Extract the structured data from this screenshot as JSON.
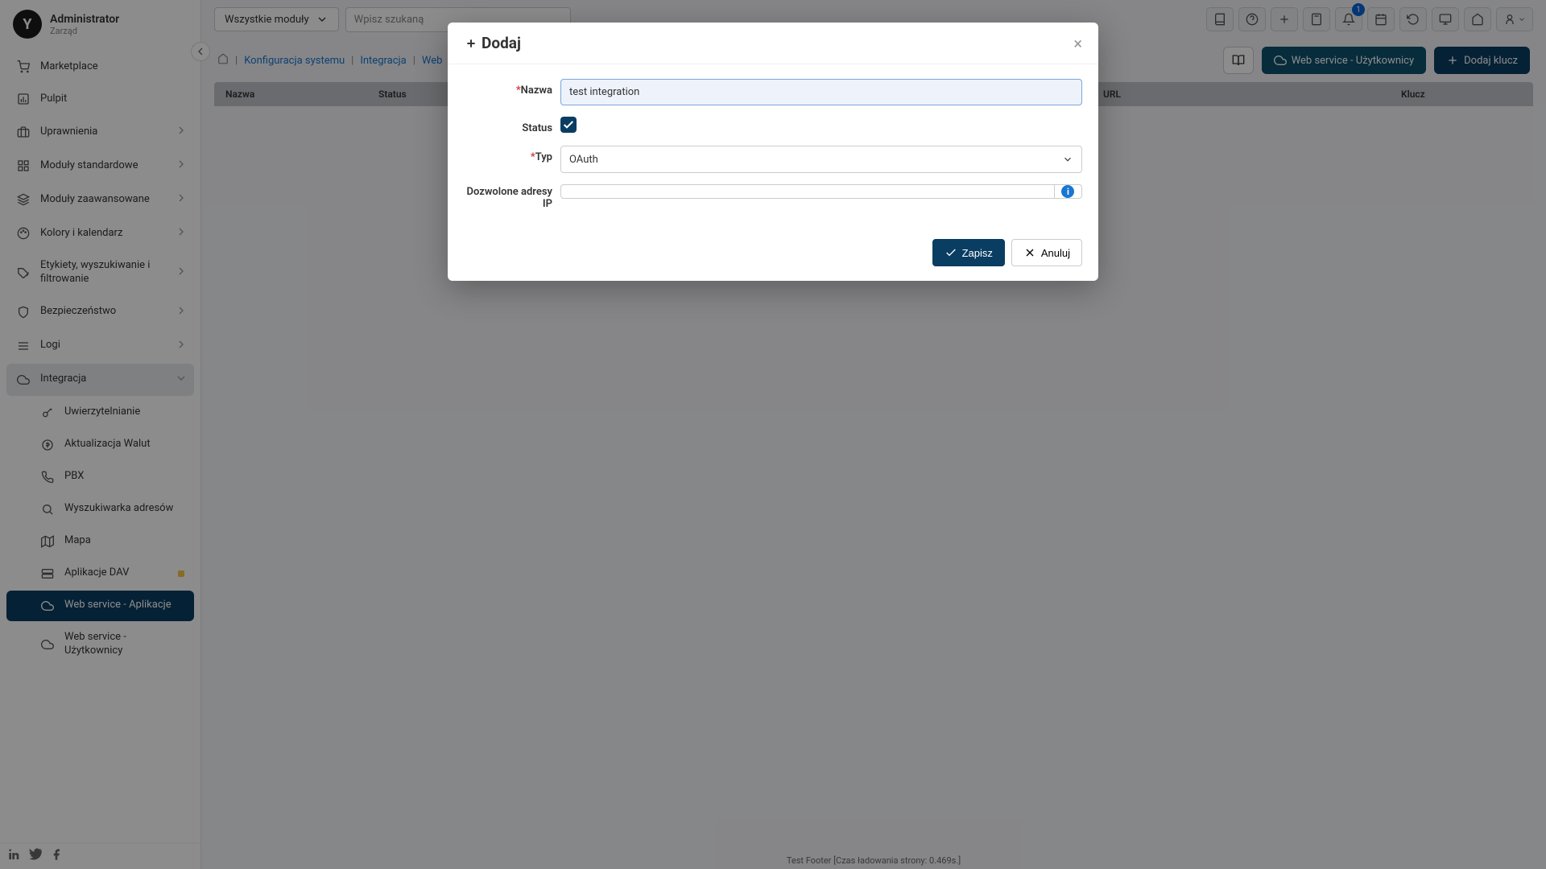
{
  "logo": "Y",
  "admin": {
    "name": "Administrator",
    "role": "Zarząd"
  },
  "topbar": {
    "module_select": "Wszystkie moduły",
    "search_placeholder": "Wpisz szukaną",
    "notif_count": "1"
  },
  "sidebar": {
    "items": [
      {
        "label": "Marketplace"
      },
      {
        "label": "Pulpit"
      },
      {
        "label": "Uprawnienia"
      },
      {
        "label": "Moduły standardowe"
      },
      {
        "label": "Moduły zaawansowane"
      },
      {
        "label": "Kolory i kalendarz"
      },
      {
        "label": "Etykiety, wyszukiwanie i filtrowanie"
      },
      {
        "label": "Bezpieczeństwo"
      },
      {
        "label": "Logi"
      },
      {
        "label": "Integracja"
      }
    ],
    "sub_items": [
      {
        "label": "Uwierzytelnianie"
      },
      {
        "label": "Aktualizacja Walut"
      },
      {
        "label": "PBX"
      },
      {
        "label": "Wyszukiwarka adresów"
      },
      {
        "label": "Mapa"
      },
      {
        "label": "Aplikacje DAV"
      },
      {
        "label": "Web service - Aplikacje"
      },
      {
        "label": "Web service - Użytkownicy"
      }
    ]
  },
  "breadcrumbs": {
    "b1": "Konfiguracja systemu",
    "b2": "Integracja",
    "b3": "Web"
  },
  "actions": {
    "web_users": "Web service - Użytkownicy",
    "add_key": "Dodaj klucz"
  },
  "table": {
    "col1": "Nazwa",
    "col2": "Status",
    "col3": "URL",
    "col4": "Klucz"
  },
  "modal": {
    "title": "Dodaj",
    "labels": {
      "name": "Nazwa",
      "status": "Status",
      "type": "Typ",
      "ips": "Dozwolone adresy IP"
    },
    "values": {
      "name": "test integration",
      "type": "OAuth"
    },
    "buttons": {
      "save": "Zapisz",
      "cancel": "Anuluj"
    }
  },
  "footer": "Test Footer [Czas ładowania strony: 0.469s.]"
}
